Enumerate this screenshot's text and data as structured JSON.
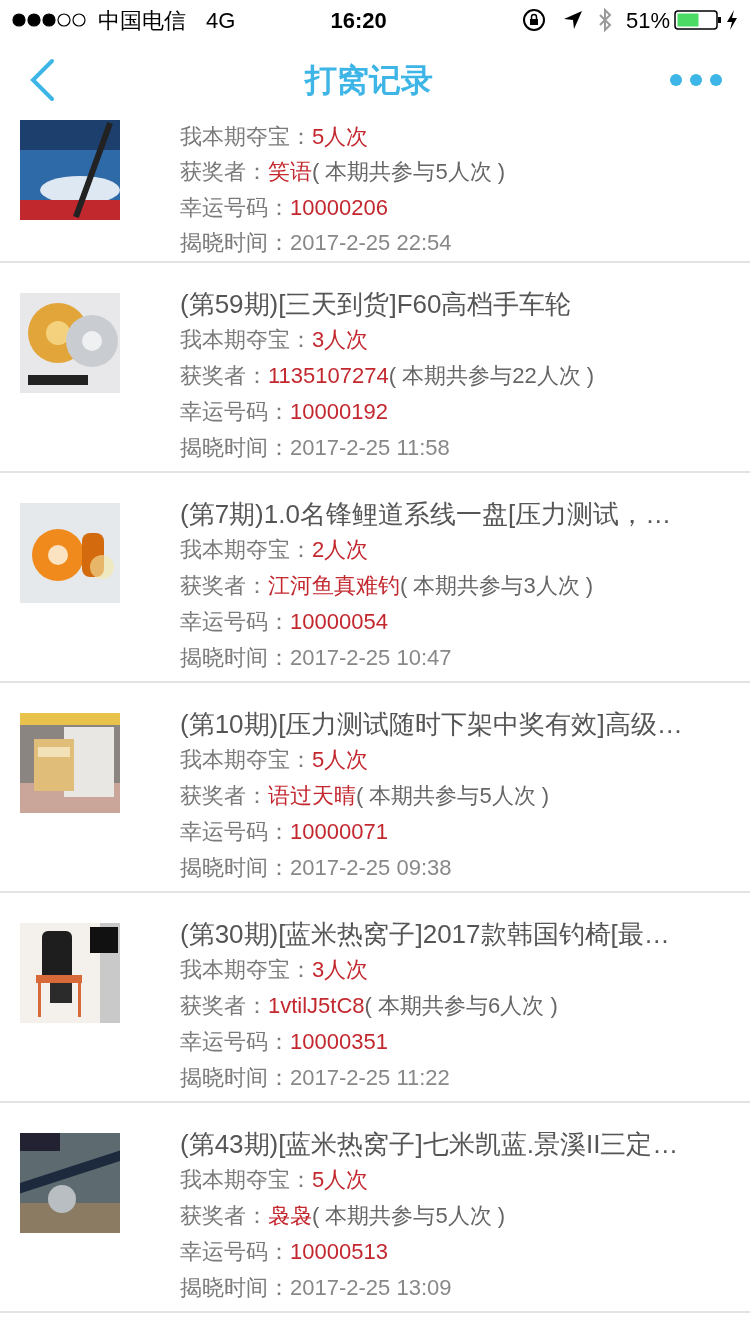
{
  "status_bar": {
    "carrier": "中国电信",
    "network": "4G",
    "time": "16:20",
    "battery": "51%"
  },
  "nav": {
    "title": "打窝记录"
  },
  "records": [
    {
      "entries_label": "我本期夺宝：",
      "entries": "5人次",
      "winner_label": "获奖者：",
      "winner": "笑语",
      "total": "( 本期共参与5人次 )",
      "code_label": "幸运号码：",
      "code": "10000206",
      "time_label": "揭晓时间：",
      "time": "2017-2-25 22:54"
    },
    {
      "title": "(第59期)[三天到货]F60高档手车轮",
      "entries_label": "我本期夺宝：",
      "entries": "3人次",
      "winner_label": "获奖者：",
      "winner": "1135107274",
      "total": "( 本期共参与22人次 )",
      "code_label": "幸运号码：",
      "code": "10000192",
      "time_label": "揭晓时间：",
      "time": "2017-2-25 11:58"
    },
    {
      "title": "(第7期)1.0名锋鲤道系线一盘[压力测试，…",
      "entries_label": "我本期夺宝：",
      "entries": "2人次",
      "winner_label": "获奖者：",
      "winner": "江河鱼真难钓",
      "total": "( 本期共参与3人次 )",
      "code_label": "幸运号码：",
      "code": "10000054",
      "time_label": "揭晓时间：",
      "time": "2017-2-25 10:47"
    },
    {
      "title": "(第10期)[压力测试随时下架中奖有效]高级…",
      "entries_label": "我本期夺宝：",
      "entries": "5人次",
      "winner_label": "获奖者：",
      "winner": "语过天晴",
      "total": "( 本期共参与5人次 )",
      "code_label": "幸运号码：",
      "code": "10000071",
      "time_label": "揭晓时间：",
      "time": "2017-2-25 09:38"
    },
    {
      "title": "(第30期)[蓝米热窝子]2017款韩国钓椅[最…",
      "entries_label": "我本期夺宝：",
      "entries": "3人次",
      "winner_label": "获奖者：",
      "winner": "1vtilJ5tC8",
      "total": "( 本期共参与6人次 )",
      "code_label": "幸运号码：",
      "code": "10000351",
      "time_label": "揭晓时间：",
      "time": "2017-2-25 11:22"
    },
    {
      "title": "(第43期)[蓝米热窝子]七米凯蓝.景溪II三定…",
      "entries_label": "我本期夺宝：",
      "entries": "5人次",
      "winner_label": "获奖者：",
      "winner": "袅袅",
      "total": "( 本期共参与5人次 )",
      "code_label": "幸运号码：",
      "code": "10000513",
      "time_label": "揭晓时间：",
      "time": "2017-2-25 13:09"
    }
  ]
}
